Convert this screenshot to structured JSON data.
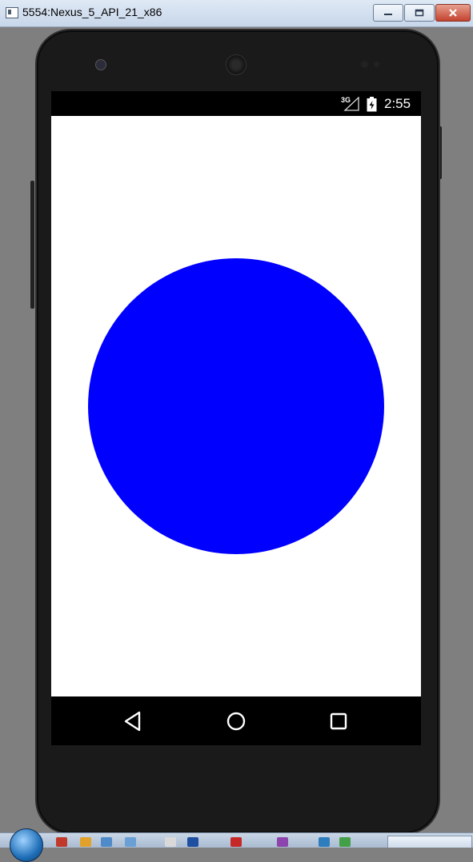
{
  "window": {
    "title": "5554:Nexus_5_API_21_x86",
    "minimize_label": "▭",
    "maximize_label": "◻",
    "close_label": "✕"
  },
  "status_bar": {
    "network": "3G",
    "time": "2:55",
    "icons": [
      "signal-icon",
      "battery-charging-icon"
    ]
  },
  "content": {
    "circle_color": "#0000ff"
  },
  "nav_bar": {
    "buttons": [
      "back-icon",
      "home-icon",
      "recents-icon"
    ]
  },
  "colors": {
    "status_bar": "#000000",
    "nav_bar": "#000000",
    "content_background": "#ffffff",
    "circle": "#0000ff"
  }
}
